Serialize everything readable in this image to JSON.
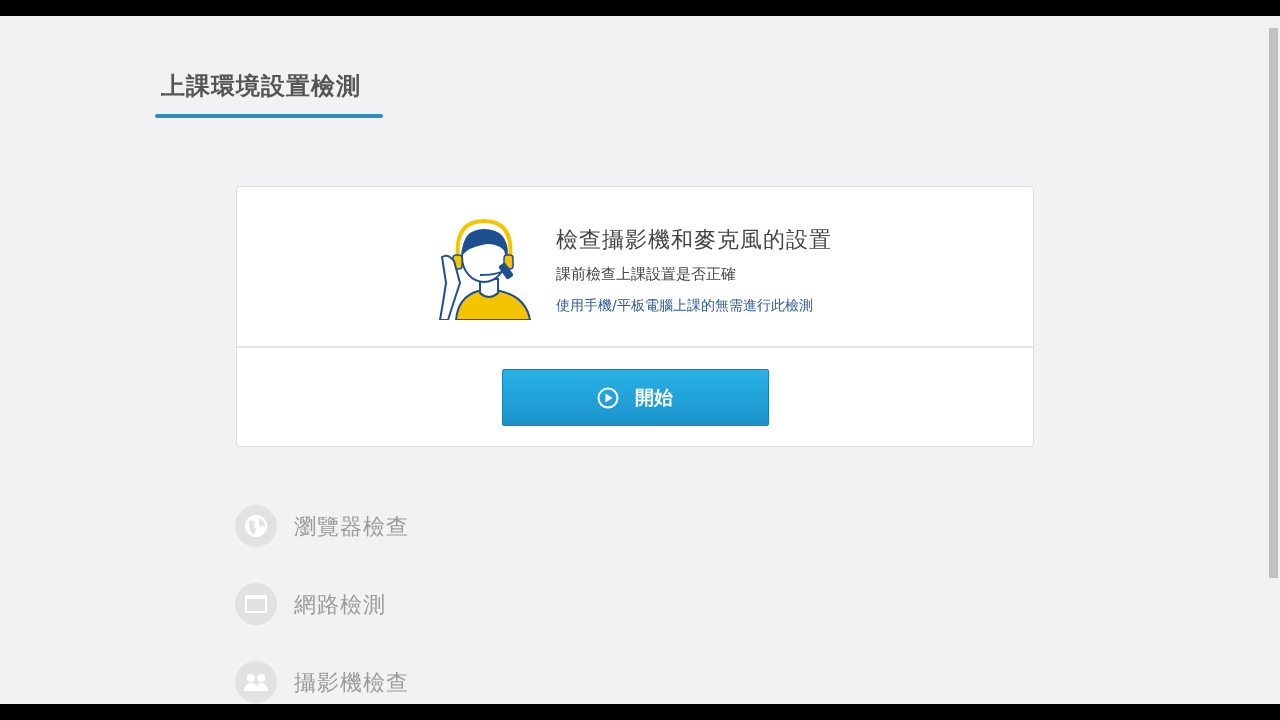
{
  "page_title": "上課環境設置檢測",
  "check_card": {
    "heading": "檢查攝影機和麥克風的設置",
    "subtitle": "課前檢查上課設置是否正確",
    "note": "使用手機/平板電腦上課的無需進行此檢測",
    "start_button": {
      "label": "開始"
    }
  },
  "steps": [
    {
      "kind": "globe",
      "label": "瀏覽器檢查",
      "done": false
    },
    {
      "kind": "window",
      "label": "網路檢測",
      "done": false
    },
    {
      "kind": "people",
      "label": "攝影機檢查",
      "done": false
    }
  ]
}
